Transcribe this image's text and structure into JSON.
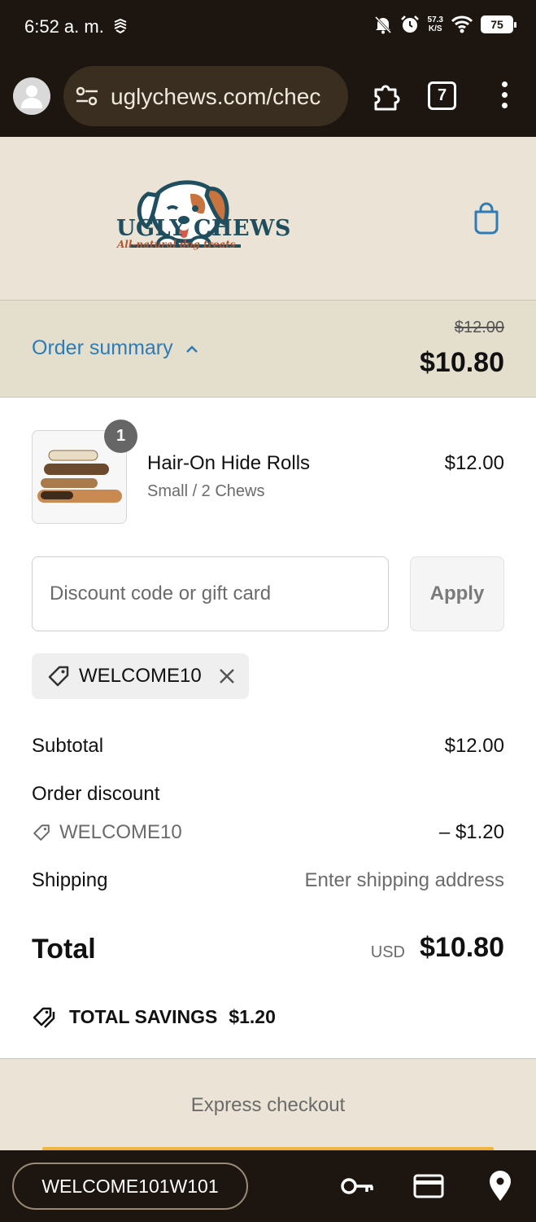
{
  "status_bar": {
    "time": "6:52 a. m.",
    "net_speed_value": "57.3",
    "net_speed_unit": "K/S",
    "battery": "75"
  },
  "browser": {
    "url": "uglychews.com/chec",
    "tab_count": "7"
  },
  "shop": {
    "brand": "UGLY CHEWS",
    "tagline": "All-natural dog treats",
    "brand_colors": {
      "navy": "#1f4e5e",
      "accent": "#b6532d"
    }
  },
  "order_summary": {
    "toggle_label": "Order summary",
    "original_price": "$12.00",
    "discounted_price": "$10.80",
    "link_color": "#2f7bb6"
  },
  "product": {
    "quantity": "1",
    "name": "Hair-On Hide Rolls",
    "variant": "Small / 2 Chews",
    "price": "$12.00"
  },
  "discount": {
    "placeholder": "Discount code or gift card",
    "value": "",
    "apply_label": "Apply",
    "applied_code": "WELCOME10"
  },
  "totals": {
    "subtotal_label": "Subtotal",
    "subtotal_value": "$12.00",
    "order_discount_label": "Order discount",
    "discount_code": "WELCOME10",
    "discount_value": "– $1.20",
    "shipping_label": "Shipping",
    "shipping_value": "Enter shipping address",
    "total_label": "Total",
    "currency": "USD",
    "total_value": "$10.80",
    "savings_label": "TOTAL SAVINGS",
    "savings_value": "$1.20"
  },
  "express": {
    "label": "Express checkout"
  },
  "keyboard": {
    "suggestion": "WELCOME101W101"
  }
}
